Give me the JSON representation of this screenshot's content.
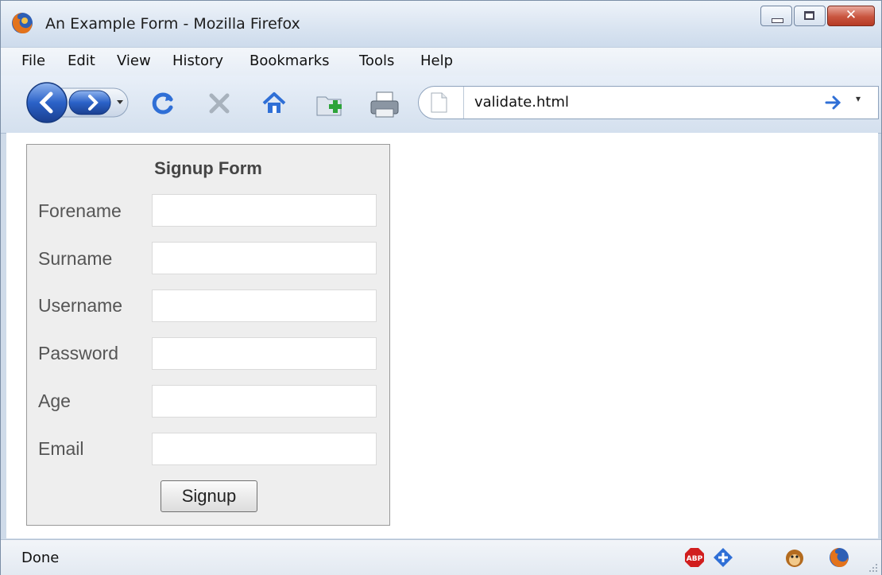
{
  "window": {
    "title": "An Example Form - Mozilla Firefox"
  },
  "menu": {
    "items": [
      "File",
      "Edit",
      "View",
      "History",
      "Bookmarks",
      "Tools",
      "Help"
    ]
  },
  "toolbar": {
    "icons": [
      "back-icon",
      "forward-icon",
      "dropdown-icon",
      "reload-icon",
      "stop-icon",
      "home-icon",
      "new-folder-icon",
      "print-icon"
    ],
    "url": "validate.html"
  },
  "form": {
    "title": "Signup Form",
    "fields": [
      {
        "label": "Forename",
        "value": ""
      },
      {
        "label": "Surname",
        "value": ""
      },
      {
        "label": "Username",
        "value": ""
      },
      {
        "label": "Password",
        "value": ""
      },
      {
        "label": "Age",
        "value": ""
      },
      {
        "label": "Email",
        "value": ""
      }
    ],
    "submit_label": "Signup"
  },
  "status": {
    "text": "Done",
    "icons": [
      "adblock-icon",
      "addon-plus-icon",
      "greasemonkey-icon",
      "firefox-icon"
    ],
    "adblock_text": "ABP"
  },
  "colors": {
    "accent": "#2f6fd6",
    "close": "#c9553f",
    "form_bg": "#eeeeee"
  }
}
